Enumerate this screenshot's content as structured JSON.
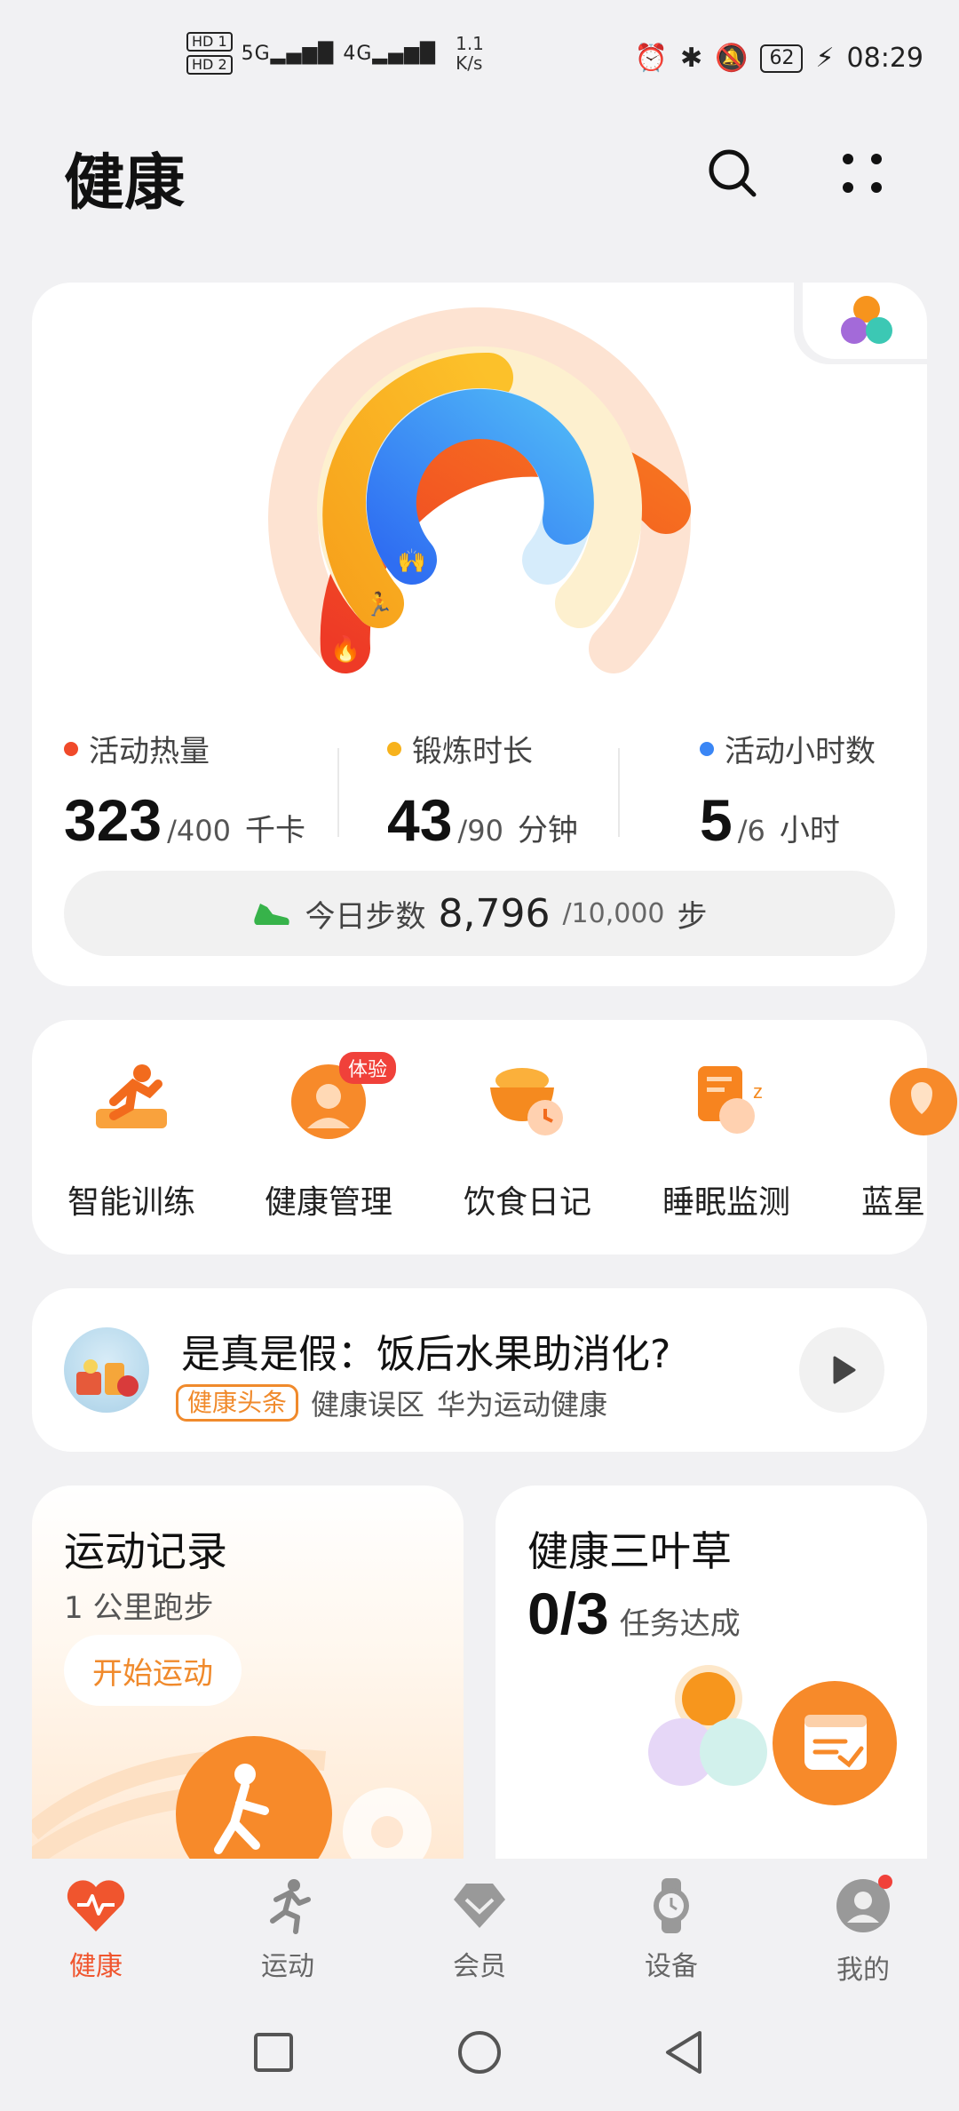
{
  "status_bar": {
    "sim1": "HD 1",
    "sim2": "HD 2",
    "signal1": "5G",
    "signal2": "4G",
    "speed_value": "1.1",
    "speed_unit": "K/s",
    "battery": "62",
    "time": "08:29"
  },
  "header": {
    "title": "健康"
  },
  "activity": {
    "calories": {
      "label": "活动热量",
      "value": "323",
      "target": "/400",
      "unit": "千卡",
      "color": "#f04a2a"
    },
    "exercise": {
      "label": "锻炼时长",
      "value": "43",
      "target": "/90",
      "unit": "分钟",
      "color": "#f7b21c"
    },
    "hours": {
      "label": "活动小时数",
      "value": "5",
      "target": "/6",
      "unit": "小时",
      "color": "#3a86f5"
    },
    "steps": {
      "label": "今日步数",
      "value": "8,796",
      "target": "/10,000",
      "unit": "步"
    }
  },
  "shortcuts": [
    {
      "label": "智能训练"
    },
    {
      "label": "健康管理",
      "badge": "体验"
    },
    {
      "label": "饮食日记"
    },
    {
      "label": "睡眠监测"
    },
    {
      "label": "蓝星"
    }
  ],
  "article": {
    "title": "是真是假：饭后水果助消化?",
    "tag": "健康头条",
    "category": "健康误区",
    "source": "华为运动健康"
  },
  "run_card": {
    "title": "运动记录",
    "subtitle": "1 公里跑步",
    "button": "开始运动"
  },
  "clover_card": {
    "title": "健康三叶草",
    "progress": "0/3",
    "progress_label": "任务达成"
  },
  "nav": [
    {
      "label": "健康",
      "icon": "heart-pulse-icon",
      "active": true
    },
    {
      "label": "运动",
      "icon": "runner-icon"
    },
    {
      "label": "会员",
      "icon": "diamond-icon"
    },
    {
      "label": "设备",
      "icon": "watch-icon"
    },
    {
      "label": "我的",
      "icon": "person-icon"
    }
  ]
}
